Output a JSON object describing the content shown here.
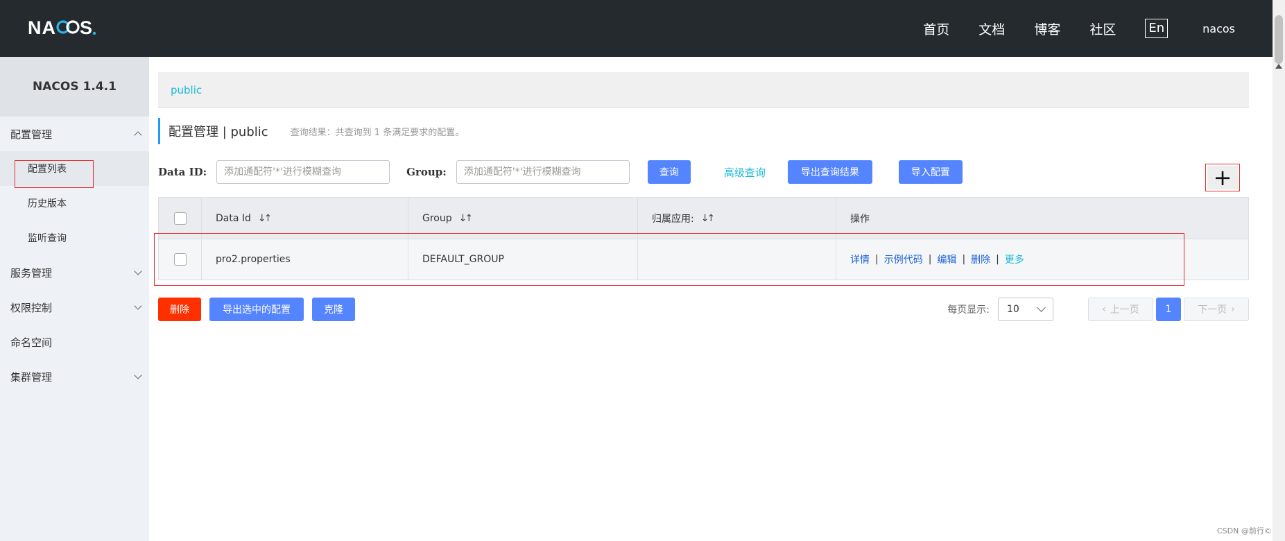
{
  "topbar": {
    "logo_text": "NACOS.",
    "nav": [
      "首页",
      "文档",
      "博客",
      "社区"
    ],
    "lang": "En",
    "user": "nacos"
  },
  "sidebar": {
    "title": "NACOS 1.4.1",
    "groups": [
      {
        "label": "配置管理",
        "expanded": true,
        "items": [
          {
            "label": "配置列表",
            "active": true
          },
          {
            "label": "历史版本",
            "active": false
          },
          {
            "label": "监听查询",
            "active": false
          }
        ]
      },
      {
        "label": "服务管理",
        "expanded": false
      },
      {
        "label": "权限控制",
        "expanded": false
      },
      {
        "label": "命名空间",
        "expanded": null
      },
      {
        "label": "集群管理",
        "expanded": false
      }
    ]
  },
  "namespace_bar": {
    "link": "public"
  },
  "page_header": {
    "title": "配置管理 | public",
    "hint": "查询结果：共查询到 1 条满足要求的配置。"
  },
  "search": {
    "dataid_label": "Data ID:",
    "dataid_placeholder": "添加通配符'*'进行模糊查询",
    "group_label": "Group:",
    "group_placeholder": "添加通配符'*'进行模糊查询",
    "query_btn": "查询",
    "advanced_link": "高级查询",
    "export_btn": "导出查询结果",
    "import_btn": "导入配置",
    "add_symbol": "+"
  },
  "table": {
    "headers": [
      "Data Id",
      "Group",
      "归属应用:",
      "操作"
    ],
    "sort_symbol": "↓↑",
    "rows": [
      {
        "data_id": "pro2.properties",
        "group": "DEFAULT_GROUP",
        "app": "",
        "ops": [
          "详情",
          "示例代码",
          "编辑",
          "删除",
          "更多"
        ]
      }
    ],
    "op_separator": "|"
  },
  "bottom": {
    "delete_btn": "删除",
    "export_selected_btn": "导出选中的配置",
    "clone_btn": "克隆",
    "page_size_label": "每页显示:",
    "page_size_value": "10",
    "prev": "上一页",
    "current_page": "1",
    "next": "下一页"
  },
  "watermark": "CSDN @前行©",
  "colors": {
    "topbar": "#252a2f",
    "primary": "#5584ff",
    "danger": "#ff3000",
    "link": "#1ab9d6",
    "highlight_box": "#e6262c"
  }
}
